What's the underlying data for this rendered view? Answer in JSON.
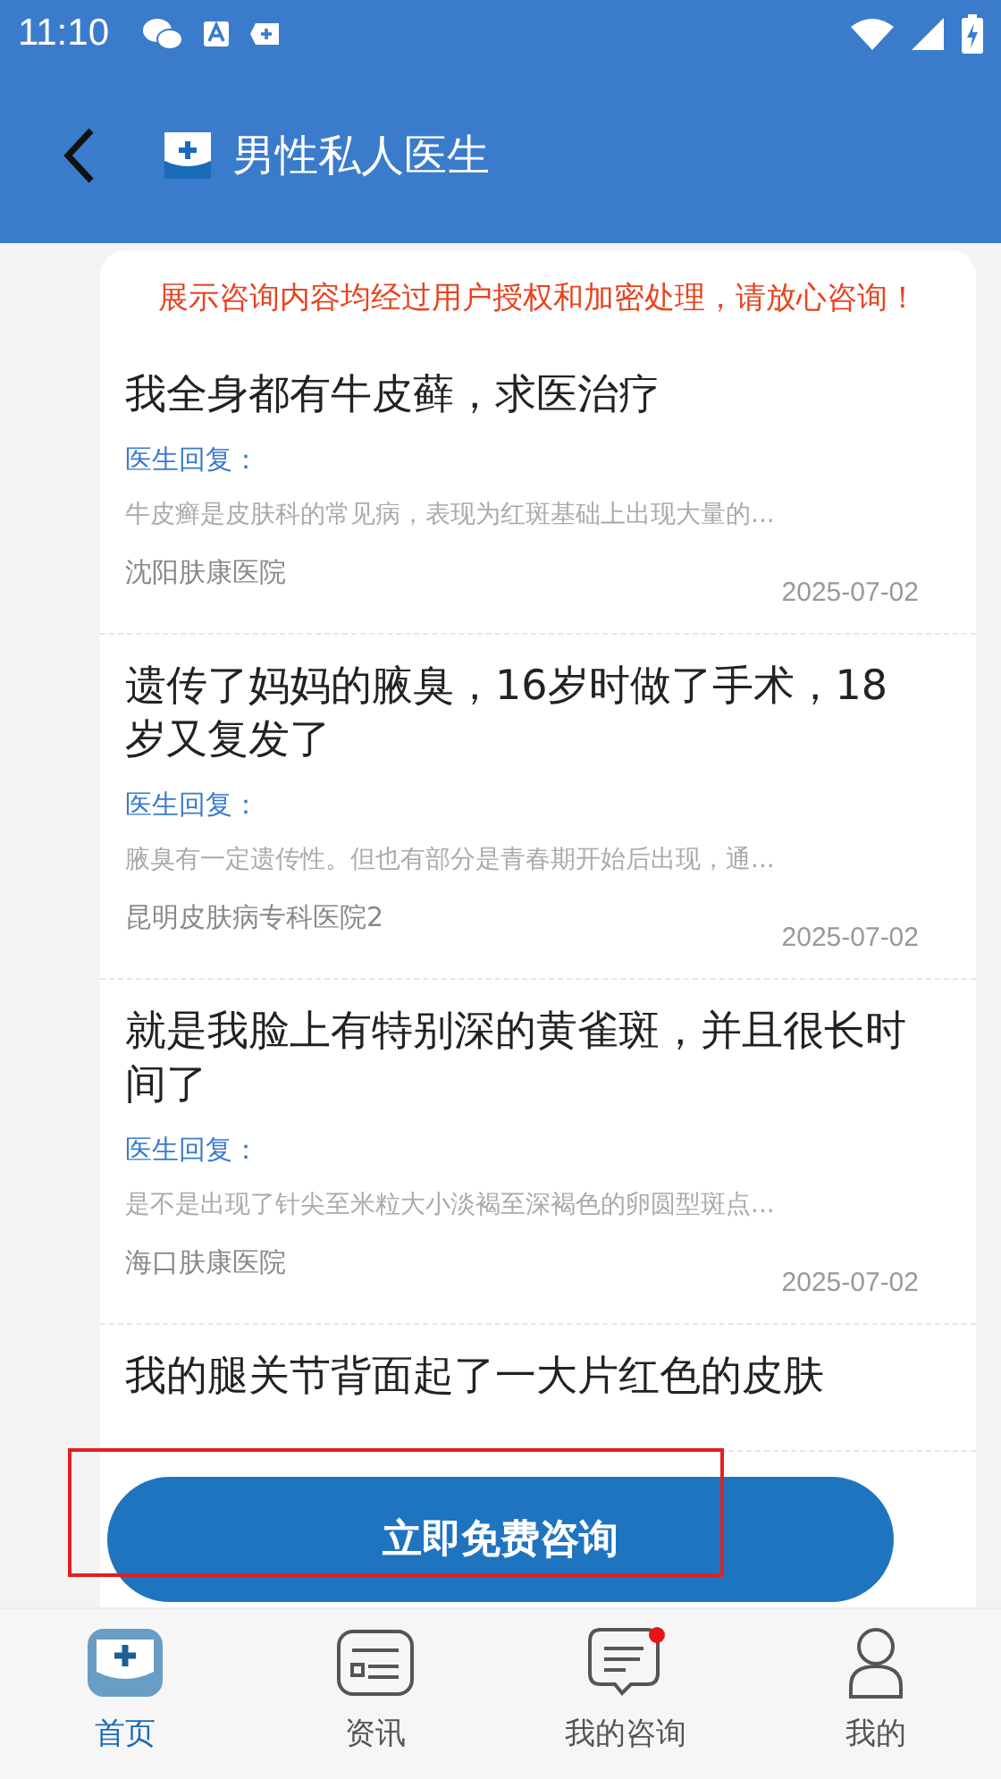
{
  "status_bar": {
    "time": "11:10"
  },
  "header": {
    "title": "男性私人医生"
  },
  "notice": "展示咨询内容均经过用户授权和加密处理，请放心咨询！",
  "consultations": [
    {
      "title": "我全身都有牛皮藓，求医治疗",
      "reply_label": "医生回复：",
      "reply": "牛皮癣是皮肤科的常见病，表现为红斑基础上出现大量的...",
      "hospital": "沈阳肤康医院",
      "date": "2025-07-02"
    },
    {
      "title": "遗传了妈妈的腋臭，16岁时做了手术，18岁又复发了",
      "reply_label": "医生回复：",
      "reply": "腋臭有一定遗传性。但也有部分是青春期开始后出现，通...",
      "hospital": "昆明皮肤病专科医院2",
      "date": "2025-07-02"
    },
    {
      "title": "就是我脸上有特别深的黄雀斑，并且很长时间了",
      "reply_label": "医生回复：",
      "reply": "是不是出现了针尖至米粒大小淡褐至深褐色的卵圆型斑点...",
      "hospital": "海口肤康医院",
      "date": "2025-07-02"
    },
    {
      "title": "我的腿关节背面起了一大片红色的皮肤"
    }
  ],
  "consult_button": "立即免费咨询",
  "tab_bar": [
    {
      "label": "首页",
      "kind": "home",
      "selected": true,
      "badge": false
    },
    {
      "label": "资讯",
      "kind": "news",
      "selected": false,
      "badge": false
    },
    {
      "label": "我的咨询",
      "kind": "consult",
      "selected": false,
      "badge": true
    },
    {
      "label": "我的",
      "kind": "profile",
      "selected": false,
      "badge": false
    }
  ]
}
